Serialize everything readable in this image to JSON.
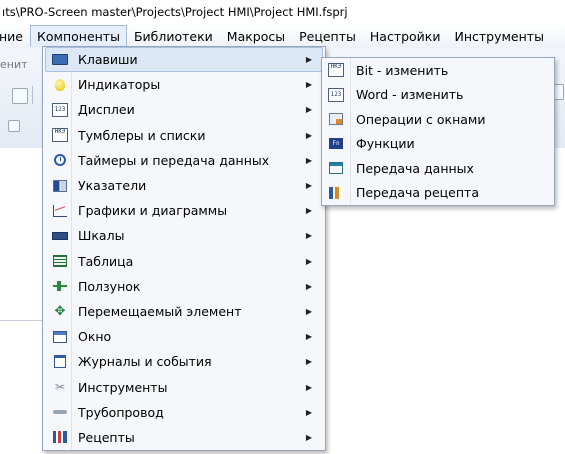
{
  "window": {
    "title_path": "ıts\\PRO-Screen master\\Projects\\Project HMI\\Project HMI.fsprj"
  },
  "menubar": {
    "items": [
      {
        "label": "ние"
      },
      {
        "label": "Компоненты",
        "active": true
      },
      {
        "label": "Библиотеки"
      },
      {
        "label": "Макросы"
      },
      {
        "label": "Рецепты"
      },
      {
        "label": "Настройки"
      },
      {
        "label": "Инструменты"
      }
    ]
  },
  "toolbar": {
    "partial_label": "енит"
  },
  "components_menu": {
    "items": [
      {
        "label": "Клавиши",
        "icon": "keyboard-icon",
        "has_submenu": true,
        "highlighted": true
      },
      {
        "label": "Индикаторы",
        "icon": "bulb-icon",
        "has_submenu": true
      },
      {
        "label": "Дисплеи",
        "icon": "numeric-display-icon",
        "has_submenu": true
      },
      {
        "label": "Тумблеры и списки",
        "icon": "toggle-icon",
        "has_submenu": true
      },
      {
        "label": "Таймеры и передача данных",
        "icon": "clock-icon",
        "has_submenu": true
      },
      {
        "label": "Указатели",
        "icon": "pointer-icon",
        "has_submenu": true
      },
      {
        "label": "Графики и диаграммы",
        "icon": "graph-icon",
        "has_submenu": true
      },
      {
        "label": "Шкалы",
        "icon": "scale-icon",
        "has_submenu": true
      },
      {
        "label": "Таблица",
        "icon": "table-icon",
        "has_submenu": true
      },
      {
        "label": "Ползунок",
        "icon": "slider-icon",
        "has_submenu": true
      },
      {
        "label": "Перемещаемый элемент",
        "icon": "move-icon",
        "has_submenu": true
      },
      {
        "label": "Окно",
        "icon": "window-icon",
        "has_submenu": true
      },
      {
        "label": "Журналы и события",
        "icon": "log-icon",
        "has_submenu": true
      },
      {
        "label": "Инструменты",
        "icon": "tools-icon",
        "has_submenu": true
      },
      {
        "label": "Трубопровод",
        "icon": "pipe-icon",
        "has_submenu": true
      },
      {
        "label": "Рецепты",
        "icon": "recipe-icon",
        "has_submenu": true
      }
    ]
  },
  "keys_submenu": {
    "items": [
      {
        "label": "Bit - изменить",
        "icon": "bit-key-icon"
      },
      {
        "label": "Word - изменить",
        "icon": "word-key-icon"
      },
      {
        "label": "Операции с окнами",
        "icon": "window-ops-icon"
      },
      {
        "label": "Функции",
        "icon": "function-icon"
      },
      {
        "label": "Передача данных",
        "icon": "data-transfer-icon"
      },
      {
        "label": "Передача рецепта",
        "icon": "recipe-transfer-icon"
      }
    ]
  },
  "colors": {
    "menu_bg": "#f5f7fb",
    "menu_border": "#97a6bd",
    "highlight_bg": "#dde8f6",
    "highlight_border": "#a9c0de"
  }
}
